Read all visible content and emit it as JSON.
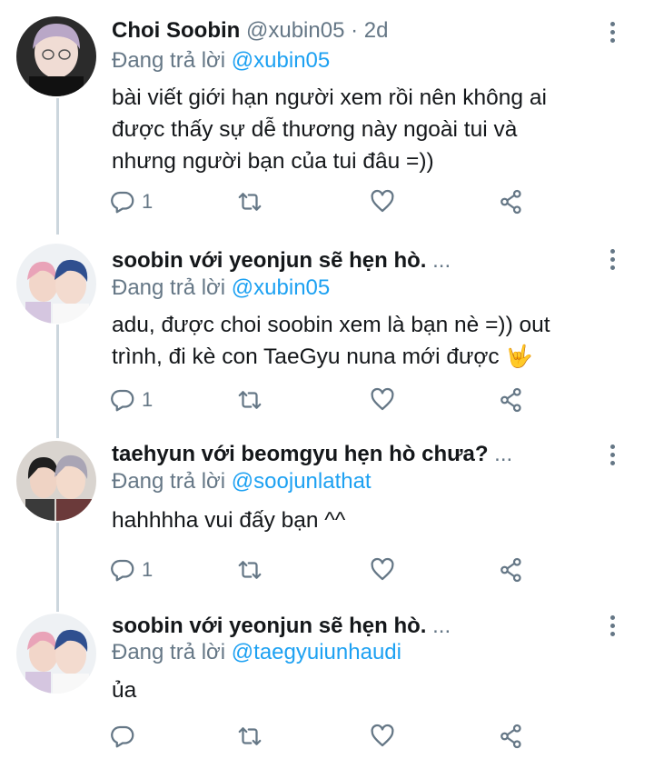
{
  "tweets": [
    {
      "name": "Choi Soobin",
      "handle": "@xubin05",
      "separator": "·",
      "time": "2d",
      "reply_prefix": "Đang trả lời",
      "reply_to": "@xubin05",
      "text_lines": [
        "bài viết giới hạn người xem rồi nên không ai",
        "được thấy sự dễ thương này ngoài tui và",
        "nhưng người bạn của tui đâu =))"
      ],
      "reply_count": "1"
    },
    {
      "name": "soobin với yeonjun sẽ hẹn hò.",
      "name_suffix": "...",
      "reply_prefix": "Đang trả lời",
      "reply_to": "@xubin05",
      "text_lines": [
        "adu, được choi soobin xem là bạn nè =)) out",
        "trình, đi kè con TaeGyu nuna mới được"
      ],
      "emoji": "🤟",
      "reply_count": "1"
    },
    {
      "name": "taehyun với beomgyu hẹn hò chưa?",
      "name_suffix": "...",
      "reply_prefix": "Đang trả lời",
      "reply_to": "@soojunlathat",
      "text_lines": [
        "hahhhha vui đấy bạn ^^"
      ],
      "reply_count": "1"
    },
    {
      "name": "soobin với yeonjun sẽ hẹn hò.",
      "name_suffix": "...",
      "reply_prefix": "Đang trả lời",
      "reply_to": "@taegyuiunhaudi",
      "text_lines": [
        "ủa"
      ],
      "reply_count": ""
    }
  ],
  "icons": {
    "reply": "reply-icon",
    "retweet": "retweet-icon",
    "like": "heart-icon",
    "share": "share-icon",
    "menu": "more-vertical-icon"
  },
  "colors": {
    "mention": "#1da1f2",
    "secondary_text": "#657786",
    "thread_line": "#ccd6dd"
  }
}
